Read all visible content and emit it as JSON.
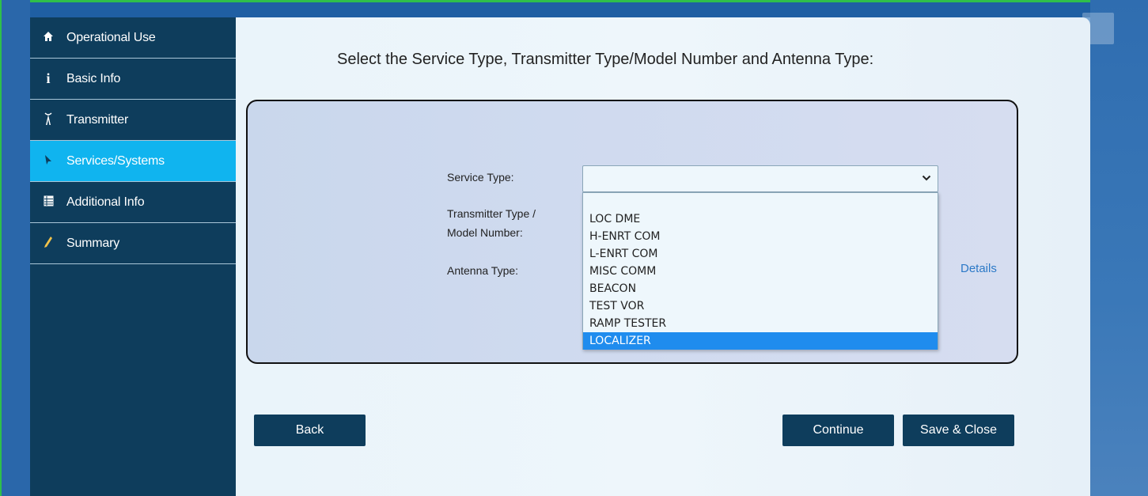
{
  "sidebar": {
    "items": [
      {
        "label": "Operational Use",
        "icon": "home-icon"
      },
      {
        "label": "Basic Info",
        "icon": "info-icon"
      },
      {
        "label": "Transmitter",
        "icon": "antenna-icon"
      },
      {
        "label": "Services/Systems",
        "icon": "services-icon"
      },
      {
        "label": "Additional Info",
        "icon": "table-icon"
      },
      {
        "label": "Summary",
        "icon": "pencil-icon"
      }
    ],
    "active_index": 3
  },
  "main": {
    "title": "Select the Service Type, Transmitter Type/Model Number and Antenna Type:",
    "service_type_label": "Service Type:",
    "transmitter_label_line1": "Transmitter Type /",
    "transmitter_label_line2": "Model Number:",
    "antenna_label": "Antenna Type:",
    "service_type_value": "",
    "details_link": "Details"
  },
  "dropdown": {
    "options": [
      "",
      "LOC DME",
      "H-ENRT COM",
      "L-ENRT COM",
      "MISC COMM",
      "BEACON",
      "TEST VOR",
      "RAMP TESTER",
      "LOCALIZER"
    ],
    "highlighted": "LOCALIZER"
  },
  "buttons": {
    "back": "Back",
    "continue": "Continue",
    "save_close": "Save & Close"
  },
  "colors": {
    "sidebar_bg": "#0e3d5c",
    "sidebar_active": "#10b4ef",
    "option_highlight": "#1f8cee",
    "link": "#2c79c7"
  }
}
